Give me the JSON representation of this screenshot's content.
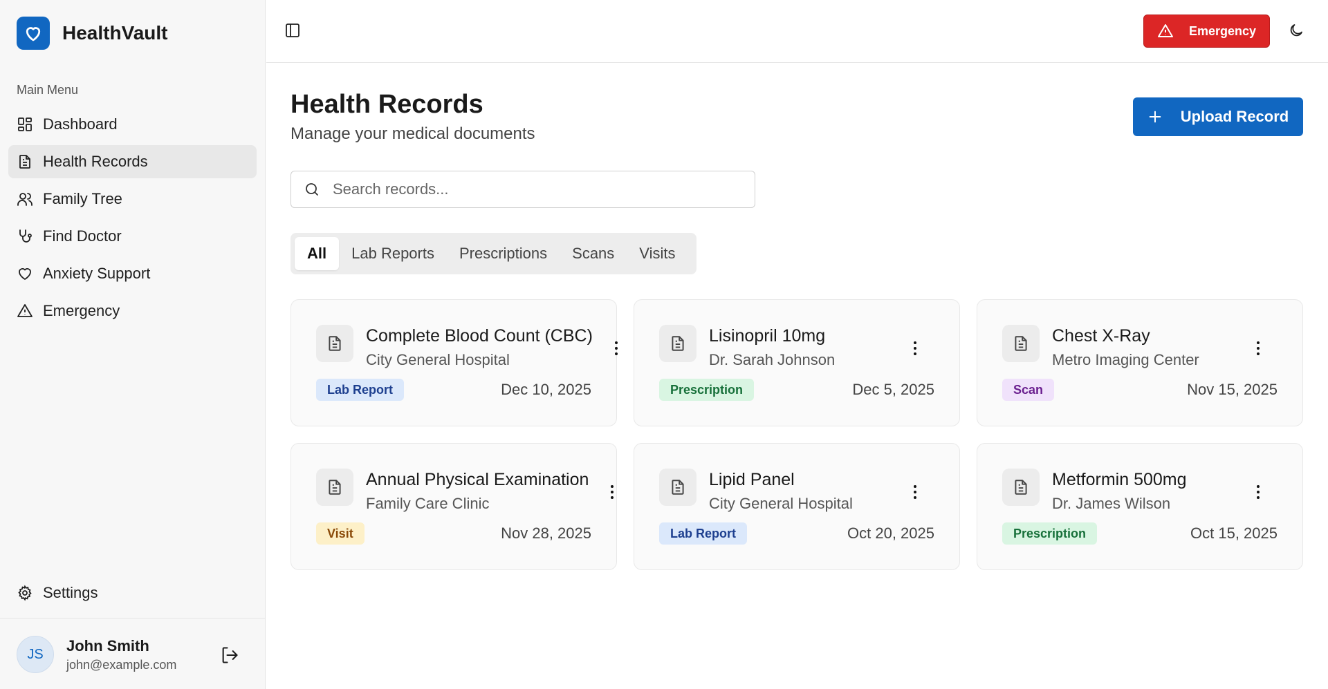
{
  "brand": {
    "name": "HealthVault"
  },
  "sidebar": {
    "menu_label": "Main Menu",
    "items": [
      {
        "label": "Dashboard",
        "icon": "dashboard-icon"
      },
      {
        "label": "Health Records",
        "icon": "document-icon",
        "active": true
      },
      {
        "label": "Family Tree",
        "icon": "users-icon"
      },
      {
        "label": "Find Doctor",
        "icon": "stethoscope-icon"
      },
      {
        "label": "Anxiety Support",
        "icon": "heart-icon"
      },
      {
        "label": "Emergency",
        "icon": "alert-triangle-icon"
      }
    ],
    "settings_label": "Settings"
  },
  "user": {
    "initials": "JS",
    "name": "John Smith",
    "email": "john@example.com"
  },
  "topbar": {
    "emergency_label": "Emergency"
  },
  "page": {
    "title": "Health Records",
    "subtitle": "Manage your medical documents",
    "upload_label": "Upload Record",
    "search_placeholder": "Search records..."
  },
  "tabs": [
    {
      "label": "All",
      "active": true
    },
    {
      "label": "Lab Reports"
    },
    {
      "label": "Prescriptions"
    },
    {
      "label": "Scans"
    },
    {
      "label": "Visits"
    }
  ],
  "records": [
    {
      "title": "Complete Blood Count (CBC)",
      "source": "City General Hospital",
      "type": "Lab Report",
      "date": "Dec 10, 2025"
    },
    {
      "title": "Lisinopril 10mg",
      "source": "Dr. Sarah Johnson",
      "type": "Prescription",
      "date": "Dec 5, 2025"
    },
    {
      "title": "Chest X-Ray",
      "source": "Metro Imaging Center",
      "type": "Scan",
      "date": "Nov 15, 2025"
    },
    {
      "title": "Annual Physical Examination",
      "source": "Family Care Clinic",
      "type": "Visit",
      "date": "Nov 28, 2025"
    },
    {
      "title": "Lipid Panel",
      "source": "City General Hospital",
      "type": "Lab Report",
      "date": "Oct 20, 2025"
    },
    {
      "title": "Metformin 500mg",
      "source": "Dr. James Wilson",
      "type": "Prescription",
      "date": "Oct 15, 2025"
    }
  ],
  "colors": {
    "primary": "#1167c1",
    "emergency": "#dc2626",
    "lab_badge": "#dbe8fb",
    "prescription_badge": "#d9f5e2",
    "scan_badge": "#f0e2fb",
    "visit_badge": "#fdf0c8"
  }
}
